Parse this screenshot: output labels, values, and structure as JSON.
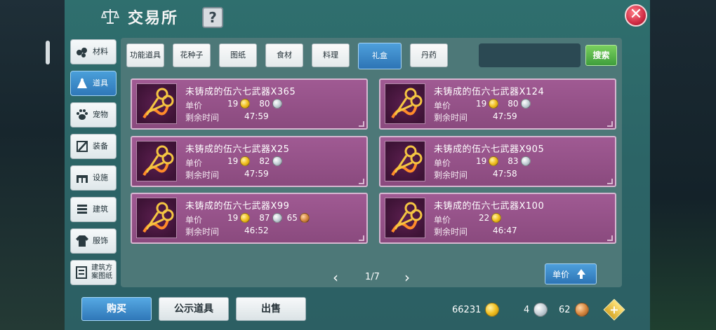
{
  "header": {
    "title": "交易所",
    "help_label": "?",
    "close_label": "✕"
  },
  "sidebar": {
    "items": [
      {
        "label": "材料",
        "icon": "material-icon",
        "active": false
      },
      {
        "label": "道具",
        "icon": "item-icon",
        "active": true
      },
      {
        "label": "宠物",
        "icon": "pet-paw-icon",
        "active": false
      },
      {
        "label": "装备",
        "icon": "equipment-icon",
        "active": false
      },
      {
        "label": "设施",
        "icon": "facility-icon",
        "active": false
      },
      {
        "label": "建筑",
        "icon": "building-icon",
        "active": false
      },
      {
        "label": "服饰",
        "icon": "clothing-icon",
        "active": false
      },
      {
        "label": "建筑方案图纸",
        "icon": "blueprint-icon",
        "active": false
      }
    ]
  },
  "tabs": [
    {
      "label": "功能道具",
      "active": false
    },
    {
      "label": "花种子",
      "active": false
    },
    {
      "label": "图纸",
      "active": false
    },
    {
      "label": "食材",
      "active": false
    },
    {
      "label": "料理",
      "active": false
    },
    {
      "label": "礼盒",
      "active": true
    },
    {
      "label": "丹药",
      "active": false
    }
  ],
  "search": {
    "placeholder": "",
    "button_label": "搜索"
  },
  "listings": [
    {
      "name": "未铸成的伍六七武器X365",
      "price_label": "单价",
      "gold": "19",
      "silver": "80",
      "copper": "",
      "time_label": "剩余时间",
      "time": "47:59"
    },
    {
      "name": "未铸成的伍六七武器X124",
      "price_label": "单价",
      "gold": "19",
      "silver": "80",
      "copper": "",
      "time_label": "剩余时间",
      "time": "47:59"
    },
    {
      "name": "未铸成的伍六七武器X25",
      "price_label": "单价",
      "gold": "19",
      "silver": "82",
      "copper": "",
      "time_label": "剩余时间",
      "time": "47:59"
    },
    {
      "name": "未铸成的伍六七武器X905",
      "price_label": "单价",
      "gold": "19",
      "silver": "83",
      "copper": "",
      "time_label": "剩余时间",
      "time": "47:58"
    },
    {
      "name": "未铸成的伍六七武器X99",
      "price_label": "单价",
      "gold": "19",
      "silver": "87",
      "copper": "65",
      "time_label": "剩余时间",
      "time": "46:52"
    },
    {
      "name": "未铸成的伍六七武器X100",
      "price_label": "单价",
      "gold": "22",
      "silver": "",
      "copper": "",
      "time_label": "剩余时间",
      "time": "46:47"
    }
  ],
  "pager": {
    "text": "1/7",
    "prev": "‹",
    "next": "›"
  },
  "sort": {
    "label": "单价"
  },
  "bottom": {
    "buy_label": "购买",
    "public_label": "公示道具",
    "sell_label": "出售"
  },
  "currency": {
    "gold": "66231",
    "silver": "4",
    "copper": "62",
    "plus_label": "+"
  },
  "colors": {
    "panel": "#2f6f6e",
    "card": "#a05a93",
    "active_tab": "#2d74b5",
    "search_button": "#3f9e3c",
    "close": "#d02c45"
  }
}
